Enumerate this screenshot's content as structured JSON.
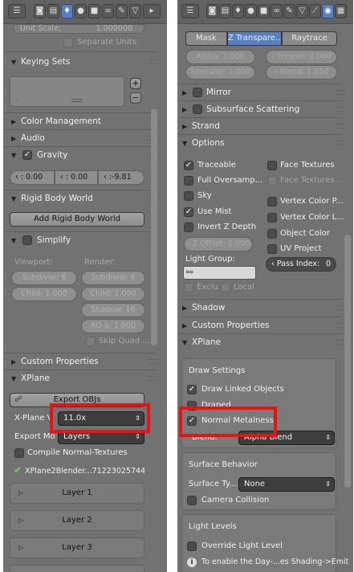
{
  "colors": {
    "highlight": "#ee1111",
    "panel": "#727272",
    "header": "#626262",
    "active_tab": "#5680c2"
  },
  "left": {
    "header_icons": [
      "editor-type-icon",
      "render-icon",
      "render-layers-icon",
      "scene-icon",
      "world-icon",
      "object-icon",
      "constraints-icon",
      "modifiers-icon",
      "data-icon"
    ],
    "unit_scale": {
      "label": "Unit Scale:",
      "value": "1.000000"
    },
    "separate_units": "Separate Units",
    "keying_sets": "Keying Sets",
    "color_management": "Color Management",
    "audio": "Audio",
    "gravity": {
      "label": "Gravity",
      "x": ": 0.00",
      "y": ": 0.00",
      "z": ":-9.81"
    },
    "rigid_body_world": "Rigid Body World",
    "add_rigid_body_world": "Add Rigid Body World",
    "simplify": {
      "label": "Simplify",
      "viewport": "Viewport:",
      "render": "Render:",
      "viewport_subdiv": "Subdivisi: 6",
      "viewport_child": "Child: 1.000",
      "render_subdiv": "Subdivisi: 6",
      "render_child": "Child: 1.000",
      "shadow": "Shadow: 16",
      "ao": "AO a: 1.000",
      "skip_quad": "Skip Quad ..."
    },
    "custom_properties": "Custom Properties",
    "xplane": {
      "label": "XPlane",
      "export_objs": "Export OBJs",
      "xplane_version_label": "X-Plane V",
      "xplane_version_value": "11.0x",
      "export_mode_label": "Export Mo",
      "export_mode_value": "Layers",
      "compile_normal_textures": "Compile Normal-Textures",
      "addon_status": "XPlane2Blender...71223025744",
      "layers": [
        "Layer 1",
        "Layer 2",
        "Layer 3"
      ]
    }
  },
  "right": {
    "header_icons": [
      "editor-type-icon",
      "render-icon",
      "render-layers-icon",
      "scene-icon",
      "world-icon",
      "object-icon",
      "constraints-icon",
      "modifiers-icon",
      "data-icon",
      "material-icon",
      "texture-icon"
    ],
    "tabs": [
      "Mask",
      "Z Transpare...",
      "Raytrace"
    ],
    "alpha": "Alpha: 1.000",
    "fresnel": "Fresnel: 0.000",
    "specular": "Specular: 1.000",
    "blend": "Blend: 1.250",
    "mirror": "Mirror",
    "subsurface": "Subsurface Scattering",
    "strand": "Strand",
    "options": {
      "label": "Options",
      "traceable": "Traceable",
      "full_oversampling": "Full Oversamp...",
      "sky": "Sky",
      "use_mist": "Use Mist",
      "invert_z": "Invert Z Depth",
      "z_offset": "Z Offset: 0.000",
      "light_group": "Light Group:",
      "exclusive": "Exclu",
      "local": "Local",
      "face_textures": "Face Textures",
      "face_textures_alpha": "Face Textures...",
      "vertex_color_paint": "Vertex Color P...",
      "vertex_color_light": "Vertex Color L...",
      "object_color": "Object Color",
      "uv_project": "UV Project",
      "pass_index": "Pass Index:",
      "pass_index_value": "0"
    },
    "shadow": "Shadow",
    "custom_properties": "Custom Properties",
    "xplane": {
      "label": "XPlane",
      "draw_settings": "Draw Settings",
      "draw_linked": "Draw Linked Objects",
      "draped": "Draped",
      "normal_metalness": "Normal Metalness",
      "blend_label": "Blend:",
      "blend_value": "Alpha Blend",
      "surface_behavior": "Surface Behavior",
      "surface_type_label": "Surface Ty...",
      "surface_type_value": "None",
      "camera_collision": "Camera Collision",
      "light_levels": "Light Levels",
      "override_light": "Override Light Level",
      "info": "To enable the Day-...es Shading->Emit"
    }
  }
}
